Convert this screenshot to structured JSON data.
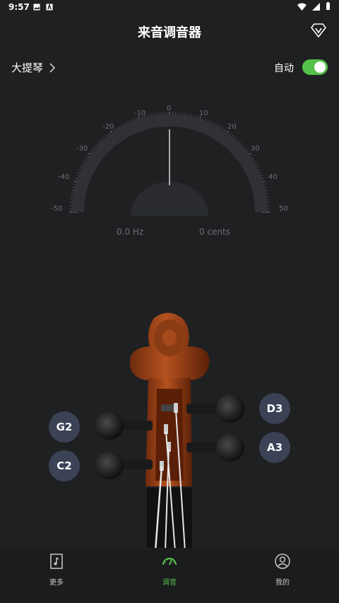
{
  "status": {
    "time": "9:57"
  },
  "header": {
    "title": "来音调音器"
  },
  "instrument": {
    "name": "大提琴"
  },
  "auto": {
    "label": "自动",
    "enabled": true
  },
  "tuner": {
    "scale_labels": [
      "-50",
      "-40",
      "-30",
      "-20",
      "-10",
      "0",
      "10",
      "20",
      "30",
      "40",
      "50"
    ],
    "frequency": "0.0 Hz",
    "cents": "0 cents"
  },
  "strings": {
    "g2": "G2",
    "c2": "C2",
    "d3": "D3",
    "a3": "A3"
  },
  "tabs": [
    {
      "label": "更多",
      "icon": "score-icon"
    },
    {
      "label": "调音",
      "icon": "gauge-icon",
      "active": true
    },
    {
      "label": "我的",
      "icon": "profile-icon"
    }
  ],
  "colors": {
    "accent": "#55c14a",
    "background": "#1f2022",
    "string_button": "#3b4256"
  }
}
